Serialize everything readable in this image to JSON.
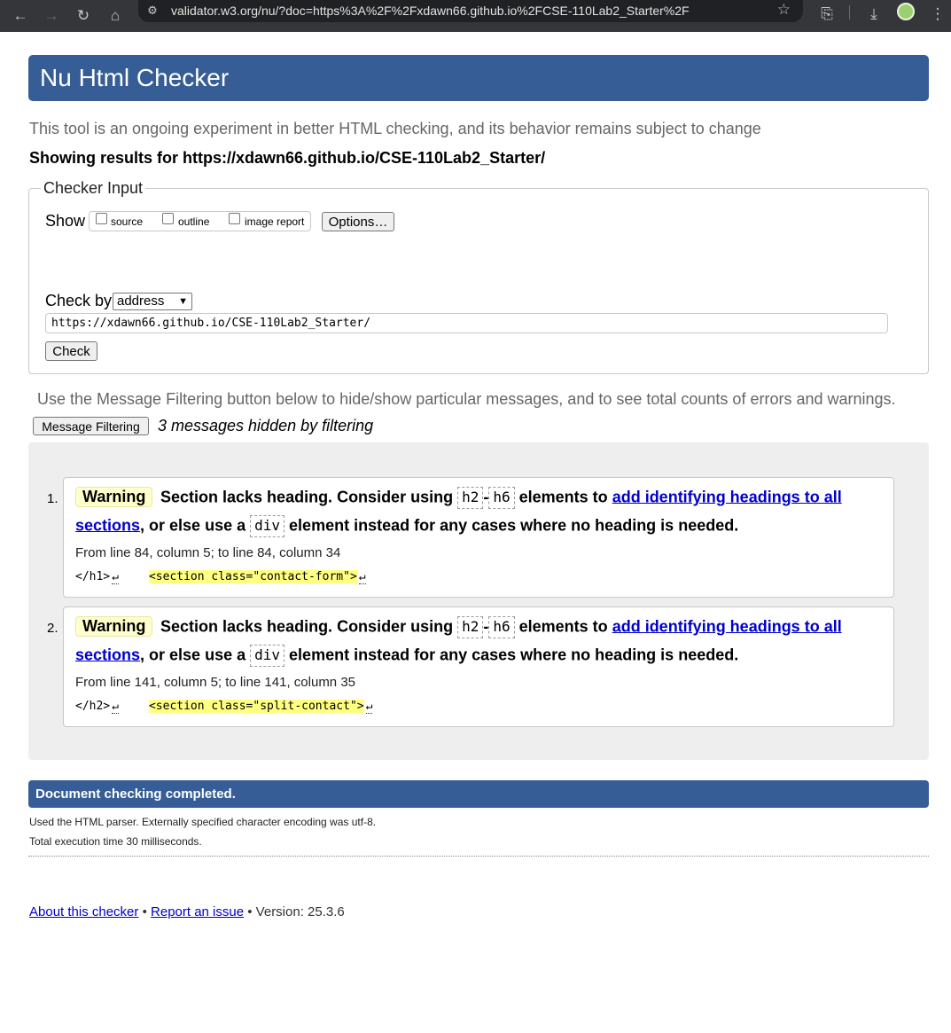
{
  "browser": {
    "url": "validator.w3.org/nu/?doc=https%3A%2F%2Fxdawn66.github.io%2FCSE-110Lab2_Starter%2F"
  },
  "page": {
    "title": "Nu Html Checker",
    "intro": "This tool is an ongoing experiment in better HTML checking, and its behavior remains subject to change",
    "results_for": "Showing results for https://xdawn66.github.io/CSE-110Lab2_Starter/"
  },
  "checker_input": {
    "legend": "Checker Input",
    "show_label": "Show",
    "show_options": [
      {
        "label": "source",
        "checked": false
      },
      {
        "label": "outline",
        "checked": false
      },
      {
        "label": "image report",
        "checked": false
      }
    ],
    "options_button": "Options…",
    "check_by_label": "Check by",
    "check_by_value": "address",
    "url_value": "https://xdawn66.github.io/CSE-110Lab2_Starter/",
    "check_button": "Check"
  },
  "filtering": {
    "note": "Use the Message Filtering button below to hide/show particular messages, and to see total counts of errors and warnings.",
    "button": "Message Filtering",
    "hidden_count": "3 messages hidden by filtering"
  },
  "messages": [
    {
      "num": "1.",
      "type": "Warning",
      "text_a": "Section lacks heading. Consider using",
      "code_a": "h2",
      "dash": "-",
      "code_b": "h6",
      "text_b": "elements to",
      "link_a": "add identifying headings to all",
      "link_b": "sections",
      "text_c": ", or else use a",
      "code_c": "div",
      "text_d": "element instead for any cases where no heading is needed.",
      "location": "From line 84, column 5; to line 84, column 34",
      "extract_pre": "</h1>",
      "extract_hl": "<section class=\"contact-form\">"
    },
    {
      "num": "2.",
      "type": "Warning",
      "text_a": "Section lacks heading. Consider using",
      "code_a": "h2",
      "dash": "-",
      "code_b": "h6",
      "text_b": "elements to",
      "link_a": "add identifying headings to all",
      "link_b": "sections",
      "text_c": ", or else use a",
      "code_c": "div",
      "text_d": "element instead for any cases where no heading is needed.",
      "location": "From line 141, column 5; to line 141, column 35",
      "extract_pre": "</h2>",
      "extract_hl": "<section class=\"split-contact\">"
    }
  ],
  "completion": {
    "title": "Document checking completed.",
    "parser_note": "Used the HTML parser. Externally specified character encoding was utf-8.",
    "time_note": "Total execution time 30 milliseconds."
  },
  "footer": {
    "about": "About this checker",
    "sep": "•",
    "report": "Report an issue",
    "version": "• Version: 25.3.6"
  },
  "icons": {
    "back": "arrow-left-icon",
    "forward": "arrow-right-icon",
    "reload": "reload-icon",
    "home": "home-icon",
    "tune": "site-settings-icon",
    "star": "bookmark-star-icon",
    "extensions": "extensions-icon",
    "download": "download-icon",
    "menu": "kebab-menu-icon"
  },
  "colors": {
    "banner": "#365d95",
    "warning_bg": "#ffffcc",
    "highlight": "#ffff80",
    "link": "#0000cc"
  }
}
